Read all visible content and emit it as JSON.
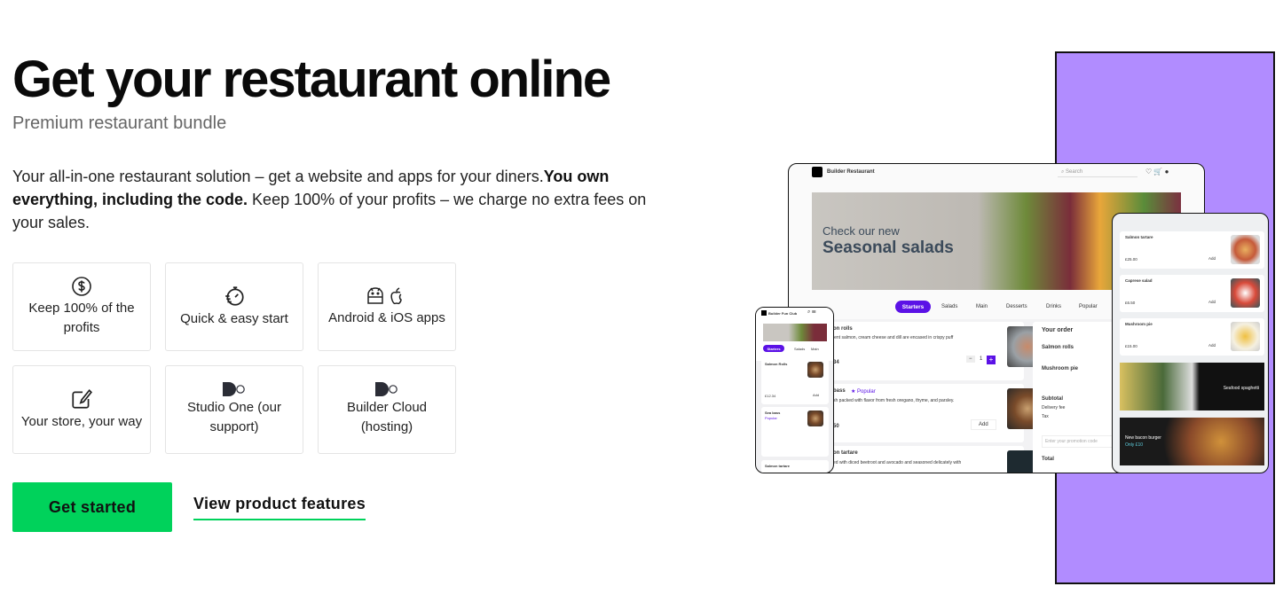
{
  "hero": {
    "title": "Get your restaurant online",
    "subtitle": "Premium restaurant bundle",
    "description_start": "Your all-in-one restaurant solution – get a website and apps for your diners.",
    "description_bold": "You own everything, including the code.",
    "description_end": " Keep 100% of your profits – we charge no extra fees on your sales."
  },
  "features": [
    {
      "label": "Keep 100% of the profits",
      "icon": "dollar-circle-icon"
    },
    {
      "label": "Quick & easy start",
      "icon": "stopwatch-icon"
    },
    {
      "label": "Android & iOS apps",
      "icon": "android-apple-icon"
    },
    {
      "label": "Your store, your way",
      "icon": "edit-icon"
    },
    {
      "label": "Studio One (our support)",
      "icon": "builder-logo-icon"
    },
    {
      "label": "Builder Cloud (hosting)",
      "icon": "builder-logo-icon"
    }
  ],
  "cta": {
    "primary": "Get started",
    "secondary": "View product features"
  },
  "colors": {
    "accent": "#00d25b",
    "panel": "#b18cff",
    "brand_purple": "#5b12e6"
  },
  "mockup": {
    "desktop": {
      "brand": "Builder Restaurant",
      "search_placeholder": "Search",
      "banner_line1": "Check our new",
      "banner_line2": "Seasonal salads",
      "tabs": [
        "Starters",
        "Salads",
        "Main",
        "Desserts",
        "Drinks",
        "Popular"
      ],
      "items": [
        {
          "name": "on rolls",
          "desc": "lent salmon, cream cheese and dill are encased in crispy puff",
          "price": "34",
          "qty": "1"
        },
        {
          "name": "bass",
          "badge": "Popular",
          "desc": "sh packed with flavor from fresh oregano, thyme, and parsley.",
          "price": "50",
          "action": "Add"
        },
        {
          "name": "on tartare",
          "desc": "ed with diced beetroot and avocado and seasoned delicately with"
        }
      ],
      "order": {
        "title": "Your order",
        "items": [
          "Salmon rolls",
          "Mushroom pie"
        ],
        "subtotal": "Subtotal",
        "delivery": "Delivery fee",
        "tax": "Tax",
        "promo_placeholder": "Enter your promotion code",
        "total": "Total"
      }
    },
    "tablet": {
      "items": [
        {
          "name": "Salmon tartare",
          "price": "£25.00",
          "action": "Add"
        },
        {
          "name": "Caprese salad",
          "price": "£6.50",
          "action": "Add"
        },
        {
          "name": "Mushroom pie",
          "price": "£15.00",
          "action": "Add"
        }
      ],
      "promo1": "Seafood spaghetti",
      "promo2_line1": "New bacon burger",
      "promo2_line2": "Only £10"
    },
    "phone": {
      "brand": "Builder Fun Club",
      "tabs": [
        "Starters",
        "Salads",
        "Main"
      ],
      "items": [
        {
          "name": "Salmon Rolls",
          "price": "£12.34",
          "action": "Add"
        },
        {
          "name": "Sea bass",
          "badge": "Popular"
        },
        {
          "name": "Salmon tartare"
        }
      ]
    }
  }
}
